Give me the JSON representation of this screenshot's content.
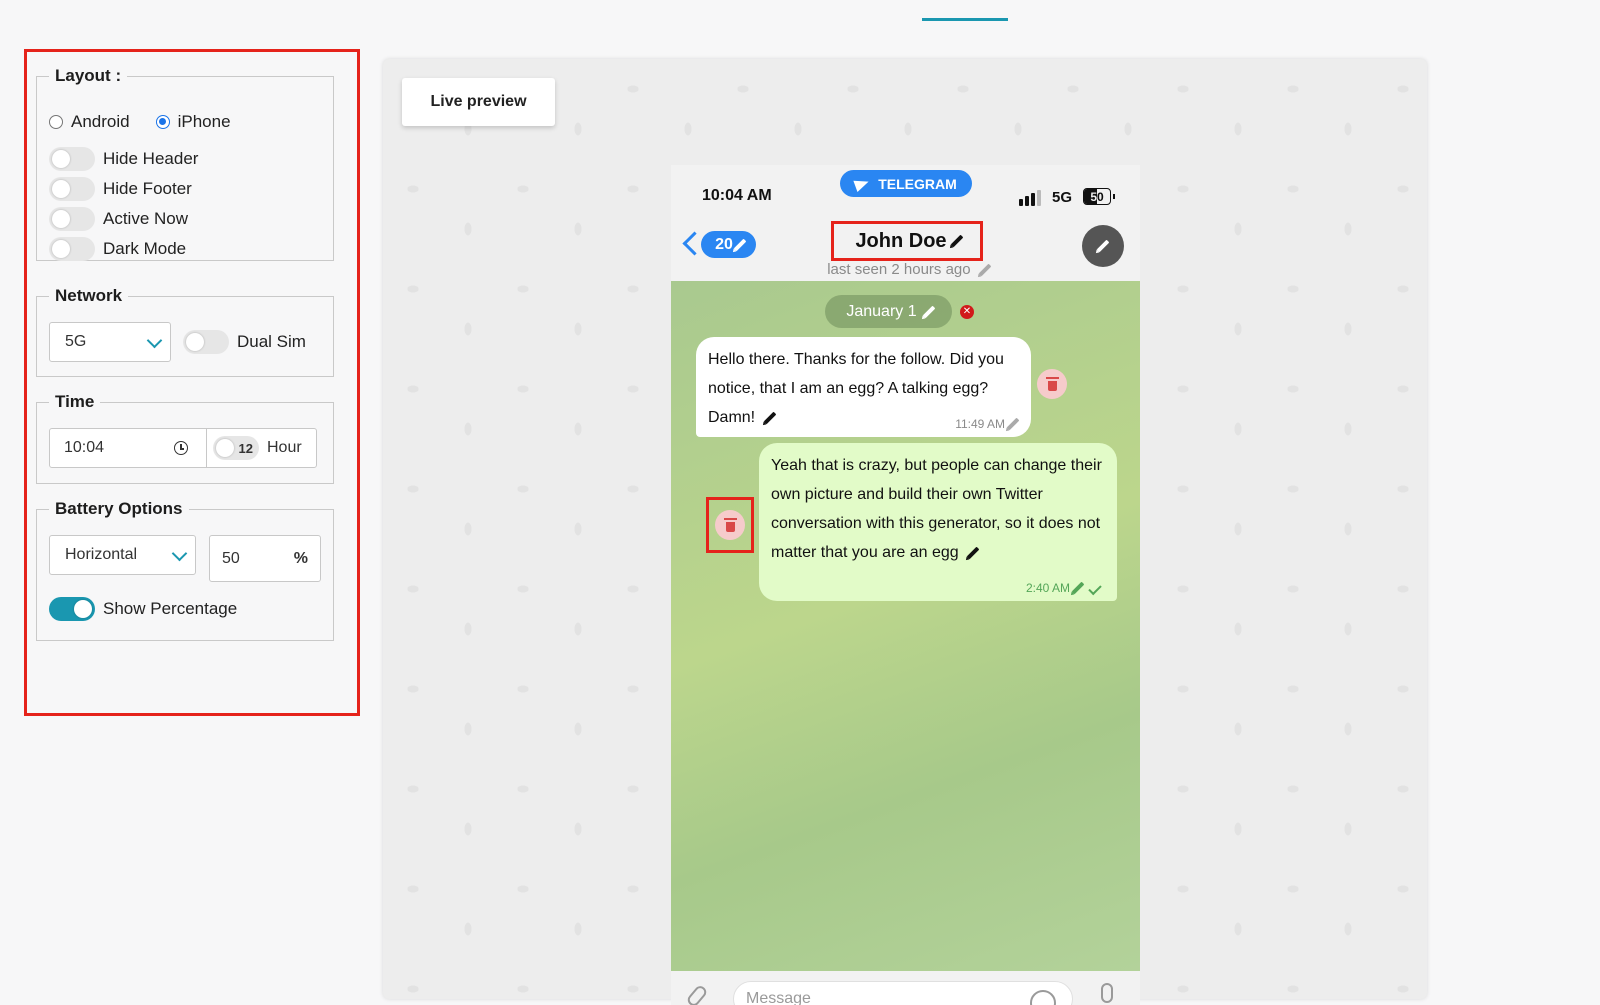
{
  "settings": {
    "layout": {
      "legend": "Layout :",
      "os_options": [
        {
          "label": "Android",
          "checked": false
        },
        {
          "label": "iPhone",
          "checked": true
        }
      ],
      "toggles": [
        {
          "label": "Hide Header",
          "on": false
        },
        {
          "label": "Hide Footer",
          "on": false
        },
        {
          "label": "Active Now",
          "on": false
        },
        {
          "label": "Dark Mode",
          "on": false
        }
      ]
    },
    "network": {
      "legend": "Network",
      "selected": "5G",
      "dual_sim_label": "Dual Sim",
      "dual_sim_on": false
    },
    "time": {
      "legend": "Time",
      "value": "10:04",
      "hour_format_value": "12",
      "hour_label": "Hour"
    },
    "battery": {
      "legend": "Battery Options",
      "orientation": "Horizontal",
      "level": "50",
      "unit": "%",
      "show_percentage_label": "Show Percentage",
      "show_percentage_on": true
    }
  },
  "preview": {
    "live_label": "Live preview",
    "status": {
      "time": "10:04 AM",
      "app_badge": "TELEGRAM",
      "network": "5G",
      "battery_level": "50",
      "battery_fraction": 0.5
    },
    "header": {
      "back_count": "20",
      "name": "John Doe",
      "last_seen": "last seen 2 hours ago"
    },
    "chat": {
      "date": "January 1",
      "messages": [
        {
          "direction": "in",
          "text": "Hello there. Thanks for the follow. Did you notice, that I am an egg? A talking egg? Damn!",
          "time": "11:49 AM"
        },
        {
          "direction": "out",
          "text": "Yeah that is crazy, but people can change their own picture and build their own Twitter conversation with this generator, so it does not matter that you are an egg",
          "time": "2:40 AM"
        }
      ]
    },
    "footer": {
      "placeholder": "Message"
    }
  },
  "colors": {
    "accent": "#1a97b0",
    "telegram_blue": "#2a86f2",
    "highlight_red": "#e5231b",
    "out_bubble": "#e2fbc8"
  }
}
